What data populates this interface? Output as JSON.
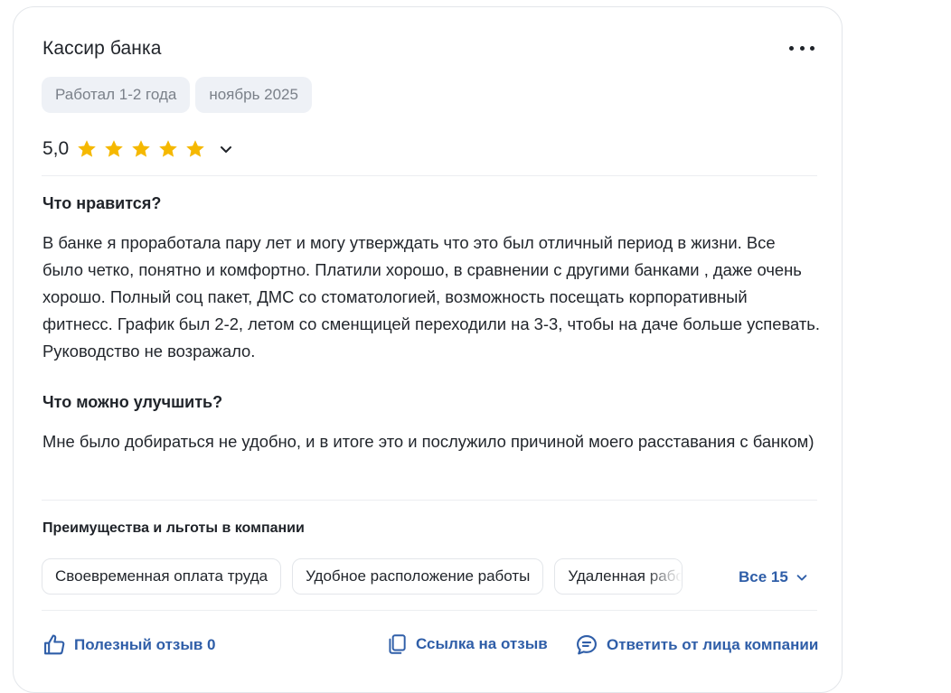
{
  "review": {
    "title": "Кассир банка",
    "tags": [
      "Работал 1-2 года",
      "ноябрь 2025"
    ],
    "rating_text": "5,0",
    "rating_value": 5,
    "rating_max": 5,
    "likes_heading": "Что нравится?",
    "likes_text": "В банке я проработала пару лет и могу утверждать что это был отличный период в жизни. Все было четко, понятно и комфортно. Платили хорошо, в сравнении с другими банками , даже очень хорошо. Полный соц пакет, ДМС со стоматологией, возможность посещать корпоративный фитнесс. График был 2-2, летом со сменщицей переходили на 3-3, чтобы на даче больше успевать. Руководство не возражало.",
    "improve_heading": "Что можно улучшить?",
    "improve_text": "Мне было добираться не удобно, и в итоге это и послужило причиной моего расставания с банком)",
    "benefits_heading": "Преимущества и льготы в компании",
    "benefits": [
      "Своевременная оплата труда",
      "Удобное расположение работы",
      "Удаленная работа"
    ],
    "benefits_all": "Все 15"
  },
  "actions": {
    "helpful": "Полезный отзыв 0",
    "link": "Ссылка на отзыв",
    "reply": "Ответить от лица компании"
  },
  "colors": {
    "accent": "#2f5ea8",
    "star": "#f5b800",
    "tag_bg": "#eef1f6"
  }
}
